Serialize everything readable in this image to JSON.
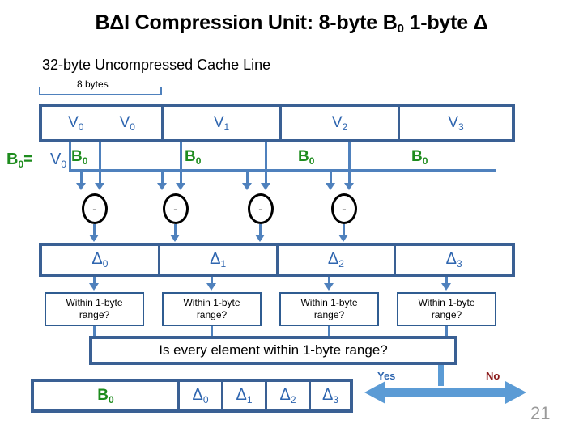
{
  "slide": {
    "title_plain": "BΔI Compression Unit: 8-byte B0 1-byte Δ",
    "title_prefix": "BΔI Compression Unit: 8-byte B",
    "title_sub": "0",
    "title_suffix": " 1-byte Δ",
    "subtitle": "32-byte Uncompressed Cache Line",
    "page_number": "21"
  },
  "dimension": {
    "label": "8 bytes"
  },
  "cache_line": {
    "cells": [
      {
        "label": "V",
        "sub": "0",
        "second_label": "V",
        "second_sub": "0"
      },
      {
        "label": "V",
        "sub": "1"
      },
      {
        "label": "V",
        "sub": "2"
      },
      {
        "label": "V",
        "sub": "3"
      }
    ]
  },
  "base_annotation": {
    "base_label": "B",
    "base_sub": "0",
    "equals": "=",
    "value_label": "V",
    "value_sub": "0"
  },
  "base_broadcast": {
    "label": "B",
    "sub": "0",
    "count": 4
  },
  "operators": {
    "symbol": "-",
    "count": 4
  },
  "delta_row": {
    "cells": [
      {
        "label": "Δ",
        "sub": "0"
      },
      {
        "label": "Δ",
        "sub": "1"
      },
      {
        "label": "Δ",
        "sub": "2"
      },
      {
        "label": "Δ",
        "sub": "3"
      }
    ]
  },
  "range_checks": [
    {
      "line1": "Within 1-byte",
      "line2": "range?"
    },
    {
      "line1": "Within 1-byte",
      "line2": "range?"
    },
    {
      "line1": "Within 1-byte",
      "line2": "range?"
    },
    {
      "line1": "Within 1-byte",
      "line2": "range?"
    }
  ],
  "decision": {
    "question": "Is every element within 1-byte range?",
    "yes_label": "Yes",
    "no_label": "No"
  },
  "compressed_result": {
    "base": {
      "label": "B",
      "sub": "0"
    },
    "deltas": [
      {
        "label": "Δ",
        "sub": "0"
      },
      {
        "label": "Δ",
        "sub": "1"
      },
      {
        "label": "Δ",
        "sub": "2"
      },
      {
        "label": "Δ",
        "sub": "3"
      }
    ]
  },
  "colors": {
    "box_border": "#3A6094",
    "wire": "#4F81BD",
    "value_blue": "#2E65AF",
    "base_green": "#1E8C1E",
    "no_red": "#8B1A1A",
    "arrow_blue": "#5B9BD5",
    "page_gray": "#9A9A9A"
  }
}
